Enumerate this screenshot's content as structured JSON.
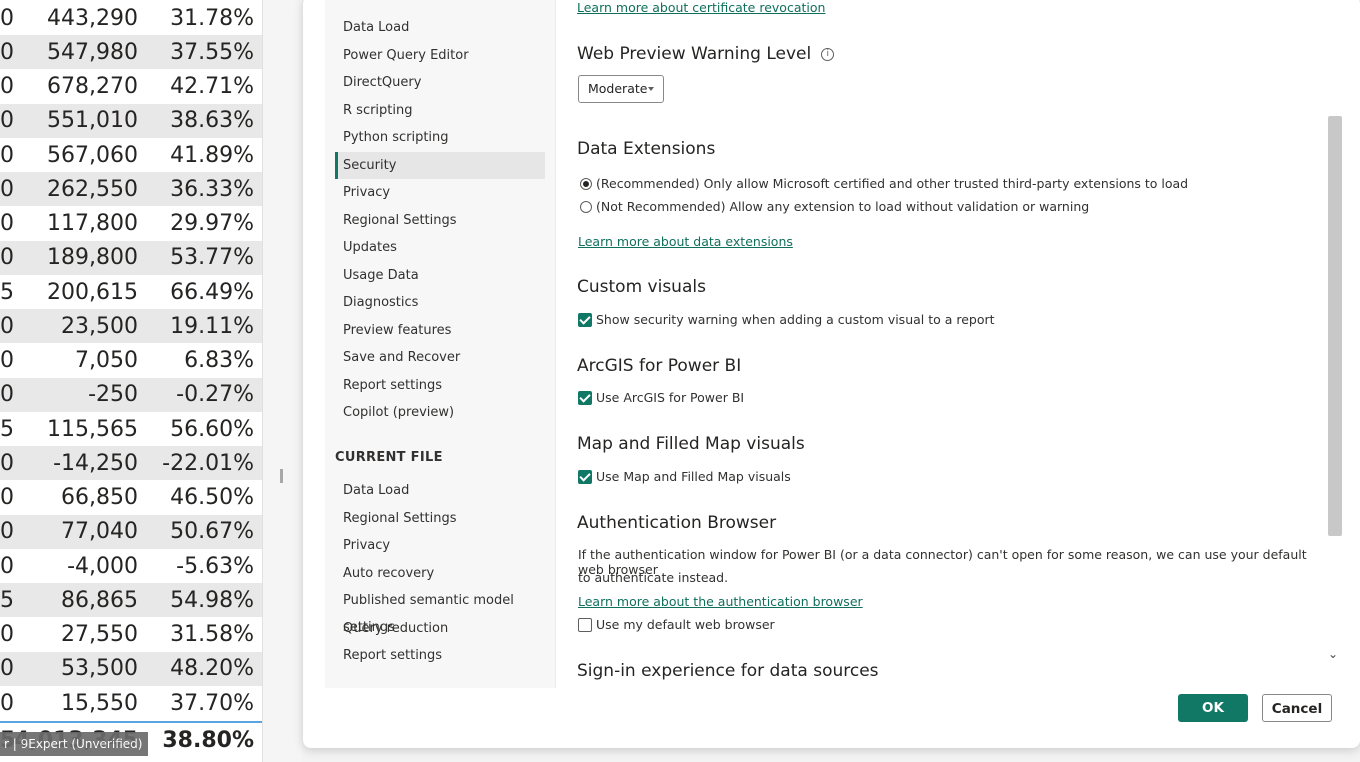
{
  "background_table": {
    "rows": [
      {
        "c0": "0",
        "c1": "443,290",
        "c2": "31.78%"
      },
      {
        "c0": "0",
        "c1": "547,980",
        "c2": "37.55%"
      },
      {
        "c0": "0",
        "c1": "678,270",
        "c2": "42.71%"
      },
      {
        "c0": "0",
        "c1": "551,010",
        "c2": "38.63%"
      },
      {
        "c0": "0",
        "c1": "567,060",
        "c2": "41.89%"
      },
      {
        "c0": "0",
        "c1": "262,550",
        "c2": "36.33%"
      },
      {
        "c0": "0",
        "c1": "117,800",
        "c2": "29.97%"
      },
      {
        "c0": "0",
        "c1": "189,800",
        "c2": "53.77%"
      },
      {
        "c0": "5",
        "c1": "200,615",
        "c2": "66.49%"
      },
      {
        "c0": "0",
        "c1": "23,500",
        "c2": "19.11%"
      },
      {
        "c0": "0",
        "c1": "7,050",
        "c2": "6.83%"
      },
      {
        "c0": "0",
        "c1": "-250",
        "c2": "-0.27%"
      },
      {
        "c0": "5",
        "c1": "115,565",
        "c2": "56.60%"
      },
      {
        "c0": "0",
        "c1": "-14,250",
        "c2": "-22.01%"
      },
      {
        "c0": "0",
        "c1": "66,850",
        "c2": "46.50%"
      },
      {
        "c0": "0",
        "c1": "77,040",
        "c2": "50.67%"
      },
      {
        "c0": "0",
        "c1": "-4,000",
        "c2": "-5.63%"
      },
      {
        "c0": "5",
        "c1": "86,865",
        "c2": "54.98%"
      },
      {
        "c0": "0",
        "c1": "27,550",
        "c2": "31.58%"
      },
      {
        "c0": "0",
        "c1": "53,500",
        "c2": "48.20%"
      },
      {
        "c0": "0",
        "c1": "15,550",
        "c2": "37.70%"
      }
    ],
    "total": {
      "c0": "5",
      "c1": "4,013,345",
      "c2": "38.80%"
    },
    "tooltip": "r | 9Expert (Unverified)"
  },
  "nav": {
    "global_items": [
      "Data Load",
      "Power Query Editor",
      "DirectQuery",
      "R scripting",
      "Python scripting",
      "Security",
      "Privacy",
      "Regional Settings",
      "Updates",
      "Usage Data",
      "Diagnostics",
      "Preview features",
      "Save and Recover",
      "Report settings",
      "Copilot (preview)"
    ],
    "selected": "Security",
    "current_file_header": "CURRENT FILE",
    "current_file_items": [
      "Data Load",
      "Regional Settings",
      "Privacy",
      "Auto recovery",
      "Published semantic model settings",
      "Query reduction",
      "Report settings"
    ]
  },
  "content": {
    "cert_link": "Learn more about certificate revocation",
    "web_preview": {
      "title": "Web Preview Warning Level",
      "info_icon": "info-icon",
      "dropdown_value": "Moderate"
    },
    "data_extensions": {
      "title": "Data Extensions",
      "option1": "(Recommended) Only allow Microsoft certified and other trusted third-party extensions to load",
      "option2": "(Not Recommended) Allow any extension to load without validation or warning",
      "selected_option": 1,
      "link": "Learn more about data extensions"
    },
    "custom_visuals": {
      "title": "Custom visuals",
      "checkbox": "Show security warning when adding a custom visual to a report",
      "checked": true
    },
    "arcgis": {
      "title": "ArcGIS for Power BI",
      "checkbox": "Use ArcGIS for Power BI",
      "checked": true
    },
    "map_visuals": {
      "title": "Map and Filled Map visuals",
      "checkbox": "Use Map and Filled Map visuals",
      "checked": true
    },
    "auth_browser": {
      "title": "Authentication Browser",
      "desc_line1": "If the authentication window for Power BI (or a data connector) can't open for some reason, we can use your default web browser",
      "desc_line2": "to authenticate instead.",
      "link": "Learn more about the authentication browser",
      "checkbox": "Use my default web browser",
      "checked": false
    },
    "sign_in": {
      "title": "Sign-in experience for data sources"
    }
  },
  "buttons": {
    "ok": "OK",
    "cancel": "Cancel"
  },
  "colors": {
    "accent": "#117865",
    "link": "#0f6f5c"
  }
}
